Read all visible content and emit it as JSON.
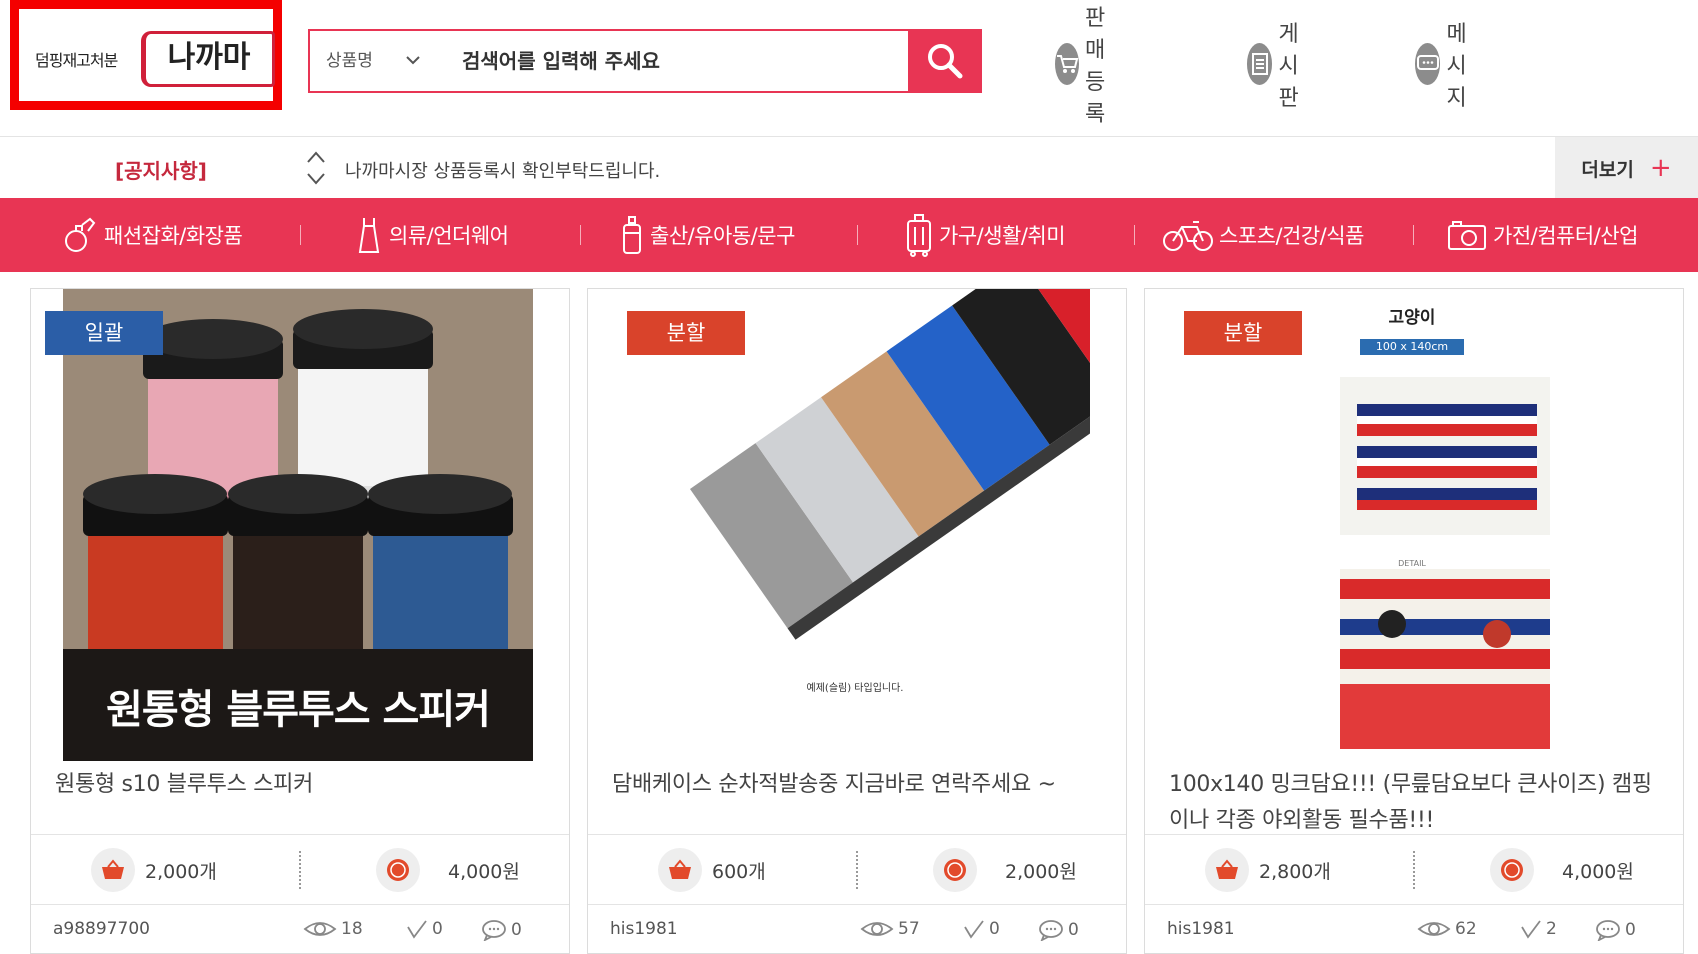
{
  "header": {
    "logo_sub": "덤핑재고처분",
    "logo_main": "나까마",
    "search_category": "상품명",
    "search_placeholder": "검색어를 입력해 주세요",
    "links": [
      {
        "label": "판매등록",
        "icon": "cart-icon"
      },
      {
        "label": "게시판",
        "icon": "document-icon"
      },
      {
        "label": "메시지",
        "icon": "message-icon"
      }
    ]
  },
  "notice": {
    "label": "[공지사항]",
    "text": "나까마시장 상품등록시 확인부탁드립니다.",
    "more": "더보기",
    "more_icon": "+"
  },
  "categories": [
    {
      "label": "패션잡화/화장품",
      "icon": "perfume-icon"
    },
    {
      "label": "의류/언더웨어",
      "icon": "dress-icon"
    },
    {
      "label": "출산/유아동/문구",
      "icon": "baby-bottle-icon"
    },
    {
      "label": "가구/생활/취미",
      "icon": "suitcase-icon"
    },
    {
      "label": "스포츠/건강/식품",
      "icon": "bicycle-icon"
    },
    {
      "label": "가전/컴퓨터/산업",
      "icon": "camera-icon"
    }
  ],
  "products": [
    {
      "badge": "일괄",
      "image_caption": "원통형 블루투스 스피커",
      "title": "원통형 s10 블루투스 스피커",
      "quantity": "2,000개",
      "price": "4,000원",
      "user": "a98897700",
      "views": "18",
      "checks": "0",
      "comments": "0"
    },
    {
      "badge": "분할",
      "image_caption": "예제(슬림) 타입입니다.",
      "title": "담배케이스 순차적발송중 지금바로 연락주세요 ~",
      "quantity": "600개",
      "price": "2,000원",
      "user": "his1981",
      "views": "57",
      "checks": "0",
      "comments": "0"
    },
    {
      "badge": "분할",
      "image_caption": "고양이",
      "image_size": "100 x 140cm",
      "image_detail": "DETAIL",
      "title": "100x140 밍크담요!!! (무릎담요보다 큰사이즈) 캠핑이나 각종 야외활동 필수품!!!",
      "quantity": "2,800개",
      "price": "4,000원",
      "user": "his1981",
      "views": "62",
      "checks": "2",
      "comments": "0"
    }
  ],
  "colors": {
    "accent": "#e83554",
    "logo_border": "#f40000",
    "badge_blue": "#2b5ea7",
    "badge_red": "#d9432b"
  }
}
